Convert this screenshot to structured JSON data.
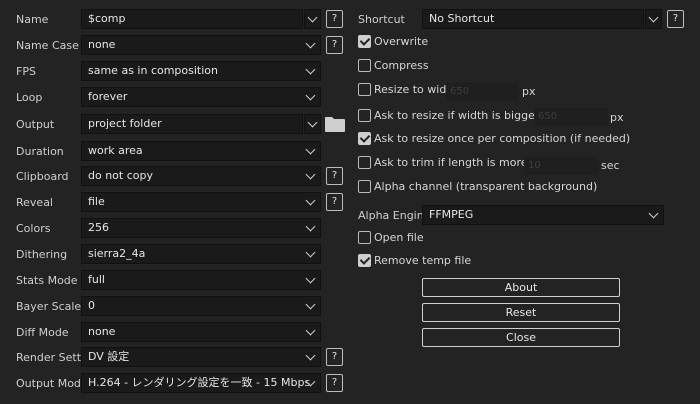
{
  "left": {
    "name": {
      "label": "Name",
      "value": "$comp",
      "help": "?"
    },
    "name_case": {
      "label": "Name Case",
      "value": "none",
      "help": "?"
    },
    "fps": {
      "label": "FPS",
      "value": "same as in composition"
    },
    "loop": {
      "label": "Loop",
      "value": "forever"
    },
    "output": {
      "label": "Output",
      "value": "project folder",
      "icon": "folder-icon"
    },
    "duration": {
      "label": "Duration",
      "value": "work area"
    },
    "clipboard": {
      "label": "Clipboard",
      "value": "do not copy",
      "help": "?"
    },
    "reveal": {
      "label": "Reveal",
      "value": "file",
      "help": "?"
    },
    "colors": {
      "label": "Colors",
      "value": "256"
    },
    "dithering": {
      "label": "Dithering",
      "value": "sierra2_4a"
    },
    "stats_mode": {
      "label": "Stats Mode",
      "value": "full"
    },
    "bayer_scale": {
      "label": "Bayer Scale",
      "value": "0"
    },
    "diff_mode": {
      "label": "Diff Mode",
      "value": "none"
    },
    "render_settings": {
      "label": "Render Settin",
      "value": "DV 設定",
      "help": "?"
    },
    "output_module": {
      "label": "Output Modul",
      "value": "H.264 - レンダリング設定を一致 - 15 Mbps",
      "help": "?"
    }
  },
  "right": {
    "shortcut": {
      "label": "Shortcut",
      "value": "No Shortcut",
      "help": "?"
    },
    "checkboxes": {
      "overwrite": {
        "label": "Overwrite",
        "checked": true
      },
      "compress": {
        "label": "Compress",
        "checked": false
      },
      "resize_width": {
        "label": "Resize to width",
        "checked": false,
        "value": "650",
        "unit": "px"
      },
      "ask_resize_bigger": {
        "label": "Ask to resize if width is bigger than",
        "checked": false,
        "value": "650",
        "unit": "px"
      },
      "ask_resize_once": {
        "label": "Ask to resize once per composition (if needed)",
        "checked": true
      },
      "ask_trim": {
        "label": "Ask to trim if length is more than",
        "checked": false,
        "value": "10",
        "unit": "sec"
      },
      "alpha_channel": {
        "label": "Alpha channel (transparent background)",
        "checked": false
      },
      "open_file": {
        "label": "Open file",
        "checked": false
      },
      "remove_temp": {
        "label": "Remove temp file",
        "checked": true
      }
    },
    "alpha_engine": {
      "label": "Alpha Engine",
      "value": "FFMPEG"
    },
    "buttons": {
      "about": "About",
      "reset": "Reset",
      "close": "Close"
    }
  }
}
